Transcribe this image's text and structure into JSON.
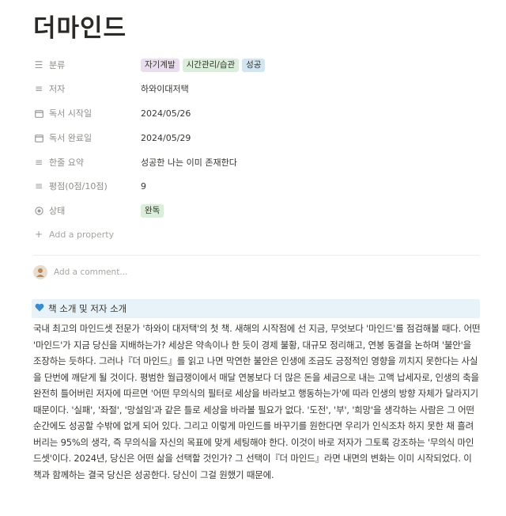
{
  "page": {
    "title": "더마인드"
  },
  "properties": [
    {
      "name": "분류",
      "icon": "list-icon",
      "type": "tags",
      "tags": [
        {
          "label": "자기계발",
          "color": "#e8deee"
        },
        {
          "label": "시간관리/습관",
          "color": "#dbeddb"
        },
        {
          "label": "성공",
          "color": "#d3e5ef"
        }
      ]
    },
    {
      "name": "저자",
      "icon": "text-icon",
      "value": "하와이대저택"
    },
    {
      "name": "독서 시작일",
      "icon": "calendar-icon",
      "value": "2024/05/26"
    },
    {
      "name": "독서 완료일",
      "icon": "calendar-icon",
      "value": "2024/05/29"
    },
    {
      "name": "한줄 요약",
      "icon": "text-icon",
      "value": "성공한 나는 이미 존재한다"
    },
    {
      "name": "평점(0점/10점)",
      "icon": "text-icon",
      "value": "9"
    },
    {
      "name": "상태",
      "icon": "status-icon",
      "tag": {
        "label": "완독",
        "color": "#dbeddb"
      }
    }
  ],
  "add_property_label": "Add a property",
  "comment_placeholder": "Add a comment...",
  "callout": {
    "icon": "heart-icon",
    "color": "#3b8bd1",
    "label": "책 소개 및 저자 소개"
  },
  "body_text": "국내 최고의 마인드셋 전문가 '하와이 대저택'의 첫 책. 새해의 시작점에 선 지금, 무엇보다 '마인드'를 점검해볼 때다. 어떤 '마인드'가 지금 당신을 지배하는가? 세상은 약속이나 한 듯이 경제 불황, 대규모 정리해고, 연봉 동결을 논하며 '불안'을 조장하는 듯하다. 그러나『더 마인드』를 읽고 나면 막연한 불안은 인생에 조금도 긍정적인 영향을 끼치지 못한다는 사실을 단번에 깨닫게 될 것이다. 평범한 월급쟁이에서 매달 연봉보다 더 많은 돈을 세금으로 내는 고액 납세자로, 인생의 축을 완전히 틀어버린 저자에 따르면 '어떤 무의식의 필터로 세상을 바라보고 행동하는가'에 따라 인생의 방향 자체가 달라지기 때문이다. '실패', '좌절', '망설임'과 같은 틀로 세상을 바라볼 필요가 없다. '도전', '부', '희망'을 생각하는 사람은 그 어떤 순간에도 성공할 수밖에 없게 되어 있다. 그리고 이렇게 마인드를 바꾸기를 원한다면 우리가 인식조차 하지 못한 채 흘려버리는 95%의 생각, 즉 무의식을 자신의 목표에 맞게 세팅해야 한다. 이것이 바로 저자가 그토록 강조하는 '무의식 마인드셋'이다. 2024년, 당신은 어떤 삶을 선택할 것인가? 그 선택이『더 마인드』라면 내면의 변화는 이미 시작되었다. 이 책과 함께하는 결국 당신은 성공한다. 당신이 그걸 원했기 때문에."
}
